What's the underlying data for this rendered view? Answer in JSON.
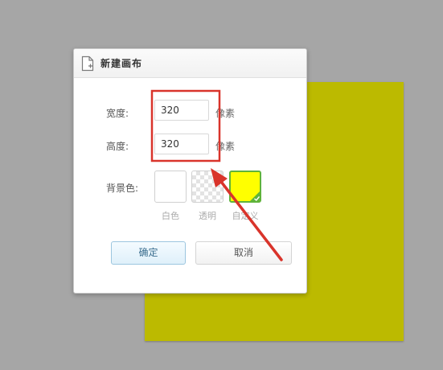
{
  "dialog": {
    "title": "新建画布",
    "icon": "new-document-icon",
    "width": {
      "label": "宽度:",
      "value": "320",
      "unit": "像素"
    },
    "height": {
      "label": "高度:",
      "value": "320",
      "unit": "像素"
    },
    "background": {
      "label": "背景色:",
      "options": [
        {
          "label": "白色",
          "color": "#ffffff",
          "selected": false
        },
        {
          "label": "透明",
          "color": "transparent",
          "selected": false
        },
        {
          "label": "自定义",
          "color": "#ffff00",
          "selected": true
        }
      ]
    },
    "buttons": {
      "ok": "确定",
      "cancel": "取消"
    }
  },
  "canvas_preview": {
    "color": "#bcba00"
  },
  "annotations": {
    "highlight_color": "#d9342b"
  }
}
